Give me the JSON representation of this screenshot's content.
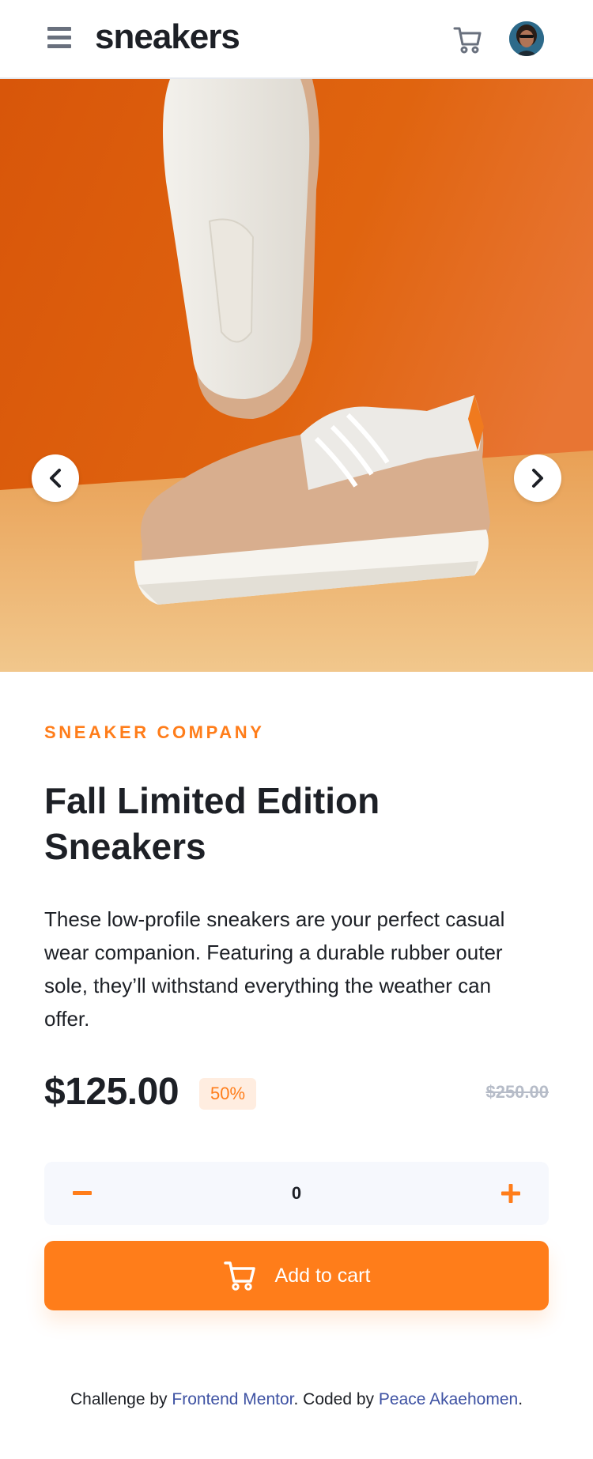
{
  "header": {
    "logo": "sneakers",
    "menu_icon": "hamburger-menu-icon",
    "cart_icon": "cart-icon",
    "avatar_icon": "user-avatar"
  },
  "gallery": {
    "prev_icon": "chevron-left-icon",
    "next_icon": "chevron-right-icon"
  },
  "product": {
    "company": "SNEAKER COMPANY",
    "title": "Fall Limited Edition Sneakers",
    "description": "These low-profile sneakers are your perfect casual wear companion. Featuring a durable rubber outer sole, they’ll withstand everything the weather can offer.",
    "price": "$125.00",
    "discount": "50%",
    "old_price": "$250.00"
  },
  "cart_controls": {
    "quantity": "0",
    "minus_icon": "minus-icon",
    "plus_icon": "plus-icon",
    "add_label": "Add to cart"
  },
  "footer": {
    "prefix": "Challenge by ",
    "mentor_link": "Frontend Mentor",
    "middle": ". Coded by ",
    "author_link": "Peace Akaehomen",
    "suffix": "."
  },
  "colors": {
    "accent": "#ff7d1a",
    "accent_pale": "#ffede0",
    "text_dark": "#1d2026",
    "text_muted": "#69707d",
    "link": "#3e52a3"
  }
}
